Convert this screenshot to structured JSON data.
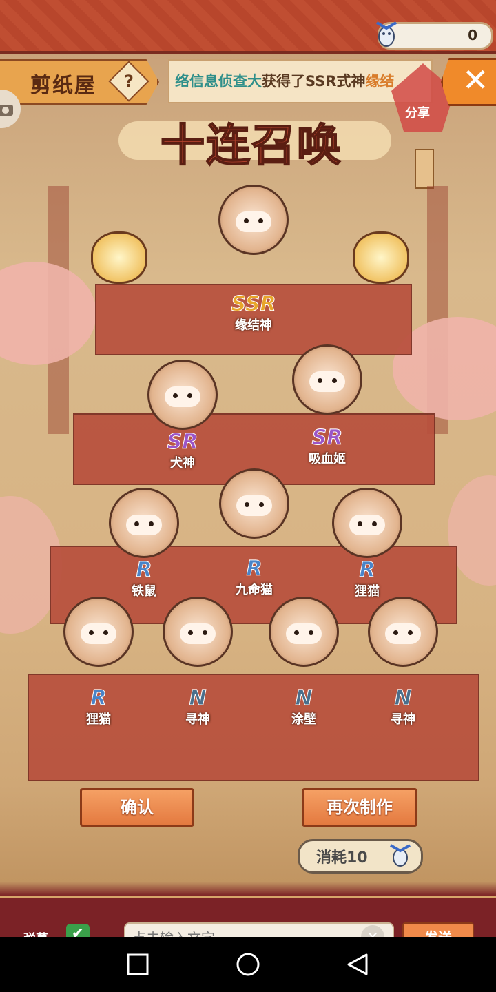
{
  "currency": {
    "amount": "0",
    "icon": "doll-currency-icon"
  },
  "header": {
    "shop_name": "剪纸屋",
    "help_symbol": "?",
    "close_symbol": "✕"
  },
  "ticker": {
    "user": "络信息侦查大",
    "middle": "获得了SSR式神",
    "highlight": "缘结"
  },
  "share_label": "分享",
  "title": "十连召唤",
  "cards": [
    {
      "rarity": "SSR",
      "name": "缘结神"
    },
    {
      "rarity": "SR",
      "name": "犬神"
    },
    {
      "rarity": "SR",
      "name": "吸血姬"
    },
    {
      "rarity": "R",
      "name": "铁鼠"
    },
    {
      "rarity": "R",
      "name": "九命猫"
    },
    {
      "rarity": "R",
      "name": "狸猫"
    },
    {
      "rarity": "R",
      "name": "狸猫"
    },
    {
      "rarity": "N",
      "name": "寻神"
    },
    {
      "rarity": "N",
      "name": "涂壁"
    },
    {
      "rarity": "N",
      "name": "寻神"
    }
  ],
  "buttons": {
    "confirm": "确认",
    "again": "再次制作",
    "cost": "消耗10"
  },
  "chat": {
    "danmu_label": "弹幕",
    "check_symbol": "✔",
    "placeholder": "点击输入文字",
    "send": "发送",
    "clear_symbol": "✕"
  },
  "colors": {
    "accent": "#f08a2a",
    "ssr": "#e8a62a",
    "sr": "#9b55c8",
    "r": "#4a84c8",
    "n": "#4a6f8c"
  }
}
